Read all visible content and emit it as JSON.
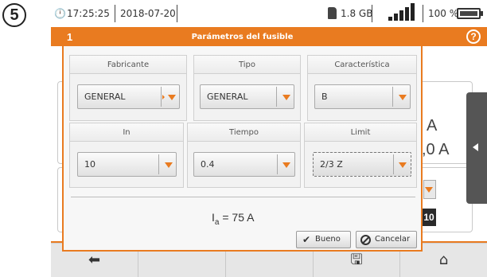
{
  "step_number": "5",
  "status": {
    "time": "17:25:25",
    "date": "2018-07-20",
    "storage": "1.8 GB",
    "battery": "100 %",
    "icons": [
      "clock-icon",
      "sd-card-icon",
      "signal-icon",
      "battery-icon",
      "plug-icon"
    ]
  },
  "dialog": {
    "number": "1",
    "title": "Parámetros del fusible",
    "groups": [
      {
        "label": "Fabricante",
        "value": "GENERAL"
      },
      {
        "label": "Tipo",
        "value": "GENERAL"
      },
      {
        "label": "Característica",
        "value": "B"
      },
      {
        "label": "In",
        "value": "10"
      },
      {
        "label": "Tiempo",
        "value": "0.4"
      },
      {
        "label": "Limit",
        "value": "2/3 Z"
      }
    ],
    "ia_symbol": "I",
    "ia_sub": "a",
    "ia_value": " = 75 A",
    "ok_label": "Bueno",
    "cancel_label": "Cancelar"
  },
  "background": {
    "text_a": "A",
    "text_0a": ",0 A",
    "badge": "10"
  },
  "colors": {
    "accent": "#e97b20",
    "toolbar": "#e6e6e6",
    "dark_tab": "#555555"
  }
}
